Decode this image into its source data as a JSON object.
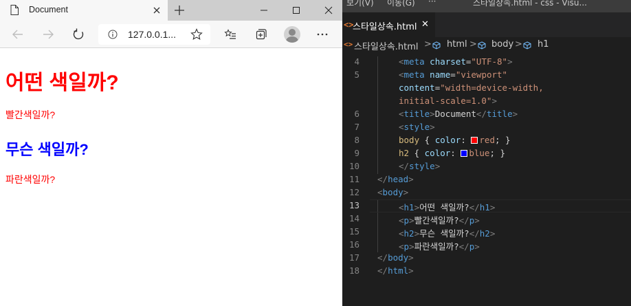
{
  "browser": {
    "tab_title": "Document",
    "url": "127.0.0.1...",
    "page": {
      "h1": "어떤 색일까?",
      "p1": "빨간색일까?",
      "h2": "무슨 색일까?",
      "p2": "파란색일까?"
    },
    "colors": {
      "h1": "#ff0000",
      "p": "#ff0000",
      "h2": "#0000ff"
    }
  },
  "editor": {
    "menu": [
      "보기(V)",
      "이동(G)",
      "···"
    ],
    "window_title": "스타일상속.html - css - Visu...",
    "tab": {
      "file_name": "스타일상속.html",
      "close": "✕"
    },
    "breadcrumb": [
      "스타일상속.html",
      "html",
      "body",
      "h1"
    ],
    "lines": [
      {
        "n": "4",
        "parts": [
          [
            "b",
            "<"
          ],
          [
            "t",
            "meta"
          ],
          [
            "x",
            " "
          ],
          [
            "a",
            "charset"
          ],
          [
            "x",
            "="
          ],
          [
            "s",
            "\"UTF-8\""
          ],
          [
            "b",
            ">"
          ]
        ]
      },
      {
        "n": "5",
        "parts": [
          [
            "b",
            "<"
          ],
          [
            "t",
            "meta"
          ],
          [
            "x",
            " "
          ],
          [
            "a",
            "name"
          ],
          [
            "x",
            "="
          ],
          [
            "s",
            "\"viewport\""
          ]
        ]
      },
      {
        "n": "",
        "parts": [
          [
            "a",
            "content"
          ],
          [
            "x",
            "="
          ],
          [
            "s",
            "\"width=device-width,"
          ]
        ]
      },
      {
        "n": "",
        "parts": [
          [
            "s",
            "initial-scale=1.0\""
          ],
          [
            "b",
            ">"
          ]
        ]
      },
      {
        "n": "6",
        "parts": [
          [
            "b",
            "<"
          ],
          [
            "t",
            "title"
          ],
          [
            "b",
            ">"
          ],
          [
            "x",
            "Document"
          ],
          [
            "b",
            "</"
          ],
          [
            "t",
            "title"
          ],
          [
            "b",
            ">"
          ]
        ]
      },
      {
        "n": "7",
        "parts": [
          [
            "b",
            "<"
          ],
          [
            "t",
            "style"
          ],
          [
            "b",
            ">"
          ]
        ]
      },
      {
        "n": "8",
        "parts": [
          [
            "sel",
            "body"
          ],
          [
            "x",
            " { "
          ],
          [
            "prop",
            "color"
          ],
          [
            "x",
            ": "
          ],
          [
            "swatch",
            "#ff0000"
          ],
          [
            "s",
            "red"
          ],
          [
            "x",
            "; }"
          ]
        ]
      },
      {
        "n": "9",
        "parts": [
          [
            "sel",
            "h2"
          ],
          [
            "x",
            " { "
          ],
          [
            "prop",
            "color"
          ],
          [
            "x",
            ": "
          ],
          [
            "swatch",
            "#0000ff"
          ],
          [
            "s",
            "blue"
          ],
          [
            "x",
            "; }"
          ]
        ]
      },
      {
        "n": "10",
        "parts": [
          [
            "b",
            "</"
          ],
          [
            "t",
            "style"
          ],
          [
            "b",
            ">"
          ]
        ]
      },
      {
        "n": "11",
        "parts": [
          [
            "b",
            "</"
          ],
          [
            "t",
            "head"
          ],
          [
            "b",
            ">"
          ]
        ]
      },
      {
        "n": "12",
        "parts": [
          [
            "b",
            "<"
          ],
          [
            "t",
            "body"
          ],
          [
            "b",
            ">"
          ]
        ]
      },
      {
        "n": "13",
        "parts": [
          [
            "b",
            "<"
          ],
          [
            "t",
            "h1"
          ],
          [
            "b",
            ">"
          ],
          [
            "x",
            "어떤 색일까?"
          ],
          [
            "b",
            "</"
          ],
          [
            "t",
            "h1"
          ],
          [
            "b",
            ">"
          ]
        ]
      },
      {
        "n": "14",
        "parts": [
          [
            "b",
            "<"
          ],
          [
            "t",
            "p"
          ],
          [
            "b",
            ">"
          ],
          [
            "x",
            "빨간색일까?"
          ],
          [
            "b",
            "</"
          ],
          [
            "t",
            "p"
          ],
          [
            "b",
            ">"
          ]
        ]
      },
      {
        "n": "15",
        "parts": [
          [
            "b",
            "<"
          ],
          [
            "t",
            "h2"
          ],
          [
            "b",
            ">"
          ],
          [
            "x",
            "무슨 색일까?"
          ],
          [
            "b",
            "</"
          ],
          [
            "t",
            "h2"
          ],
          [
            "b",
            ">"
          ]
        ]
      },
      {
        "n": "16",
        "parts": [
          [
            "b",
            "<"
          ],
          [
            "t",
            "p"
          ],
          [
            "b",
            ">"
          ],
          [
            "x",
            "파란색일까?"
          ],
          [
            "b",
            "</"
          ],
          [
            "t",
            "p"
          ],
          [
            "b",
            ">"
          ]
        ]
      },
      {
        "n": "17",
        "parts": [
          [
            "b",
            "</"
          ],
          [
            "t",
            "body"
          ],
          [
            "b",
            ">"
          ]
        ]
      },
      {
        "n": "18",
        "parts": [
          [
            "b",
            "</"
          ],
          [
            "t",
            "html"
          ],
          [
            "b",
            ">"
          ]
        ]
      }
    ],
    "active_line": "13",
    "syntax_colors": {
      "tag": "#569cd6",
      "bracket": "#808080",
      "attribute": "#9cdcfe",
      "string": "#ce9178",
      "text": "#d4d4d4",
      "selector": "#d7ba7d"
    }
  }
}
